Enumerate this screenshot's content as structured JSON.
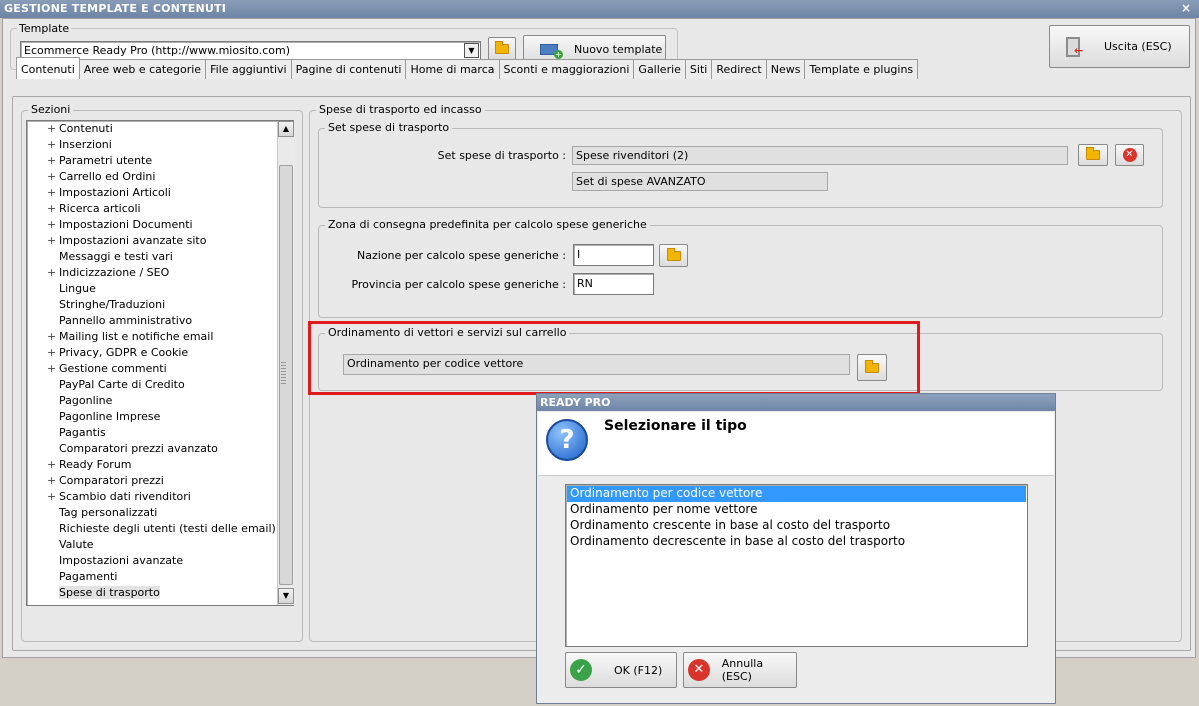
{
  "window": {
    "title": "GESTIONE TEMPLATE E CONTENUTI",
    "close_glyph": "×"
  },
  "template": {
    "label": "Template",
    "selected": "Ecommerce Ready Pro (http://www.miosito.com)",
    "new_button": "Nuovo template"
  },
  "exit_button": "Uscita (ESC)",
  "tabs": [
    "Contenuti",
    "Aree web e categorie",
    "File aggiuntivi",
    "Pagine di contenuti",
    "Home di marca",
    "Sconti e maggiorazioni",
    "Gallerie",
    "Siti",
    "Redirect",
    "News",
    "Template e plugins"
  ],
  "sections": {
    "label": "Sezioni",
    "items": [
      {
        "label": "Contenuti",
        "expandable": true
      },
      {
        "label": "Inserzioni",
        "expandable": true
      },
      {
        "label": "Parametri utente",
        "expandable": true
      },
      {
        "label": "Carrello ed Ordini",
        "expandable": true
      },
      {
        "label": "Impostazioni Articoli",
        "expandable": true
      },
      {
        "label": "Ricerca articoli",
        "expandable": true
      },
      {
        "label": "Impostazioni Documenti",
        "expandable": true
      },
      {
        "label": "Impostazioni avanzate sito",
        "expandable": true
      },
      {
        "label": "Messaggi e testi vari",
        "expandable": false
      },
      {
        "label": "Indicizzazione / SEO",
        "expandable": true
      },
      {
        "label": "Lingue",
        "expandable": false
      },
      {
        "label": "Stringhe/Traduzioni",
        "expandable": false
      },
      {
        "label": "Pannello amministrativo",
        "expandable": false
      },
      {
        "label": "Mailing list e notifiche email",
        "expandable": true
      },
      {
        "label": "Privacy, GDPR e Cookie",
        "expandable": true
      },
      {
        "label": "Gestione commenti",
        "expandable": true
      },
      {
        "label": "PayPal Carte di Credito",
        "expandable": false
      },
      {
        "label": "Pagonline",
        "expandable": false
      },
      {
        "label": "Pagonline Imprese",
        "expandable": false
      },
      {
        "label": "Pagantis",
        "expandable": false
      },
      {
        "label": "Comparatori prezzi avanzato",
        "expandable": false
      },
      {
        "label": "Ready Forum",
        "expandable": true
      },
      {
        "label": "Comparatori prezzi",
        "expandable": true
      },
      {
        "label": "Scambio dati rivenditori",
        "expandable": true
      },
      {
        "label": "Tag personalizzati",
        "expandable": false
      },
      {
        "label": "Richieste degli utenti (testi delle email)",
        "expandable": false
      },
      {
        "label": "Valute",
        "expandable": false
      },
      {
        "label": "Impostazioni avanzate",
        "expandable": false
      },
      {
        "label": "Pagamenti",
        "expandable": false
      },
      {
        "label": "Spese di trasporto",
        "expandable": false,
        "selected": true
      }
    ]
  },
  "panel": {
    "title": "Spese di trasporto ed incasso",
    "set_group": {
      "legend": "Set spese di trasporto",
      "field_label": "Set spese di trasporto :",
      "field_value": "Spese rivenditori (2)",
      "sub_value": "Set di spese AVANZATO"
    },
    "zone_group": {
      "legend": "Zona di consegna predefinita per calcolo spese generiche",
      "nation_label": "Nazione per calcolo spese generiche :",
      "nation_value": "I",
      "province_label": "Provincia per calcolo spese generiche :",
      "province_value": "RN"
    },
    "order_group": {
      "legend": "Ordinamento di vettori e servizi sul carrello",
      "value": "Ordinamento per codice vettore"
    }
  },
  "dialog": {
    "title": "READY PRO",
    "heading": "Selezionare il tipo",
    "icon_glyph": "?",
    "options": [
      "Ordinamento per codice vettore",
      "Ordinamento per nome vettore",
      "Ordinamento crescente in base al costo del trasporto",
      "Ordinamento decrescente in base al costo del trasporto"
    ],
    "ok_button": "OK (F12)",
    "cancel_button": "Annulla (ESC)"
  },
  "colors": {
    "highlight_border": "#e01b1b",
    "selection": "#3399ff",
    "titlebar": "#7990b0"
  }
}
